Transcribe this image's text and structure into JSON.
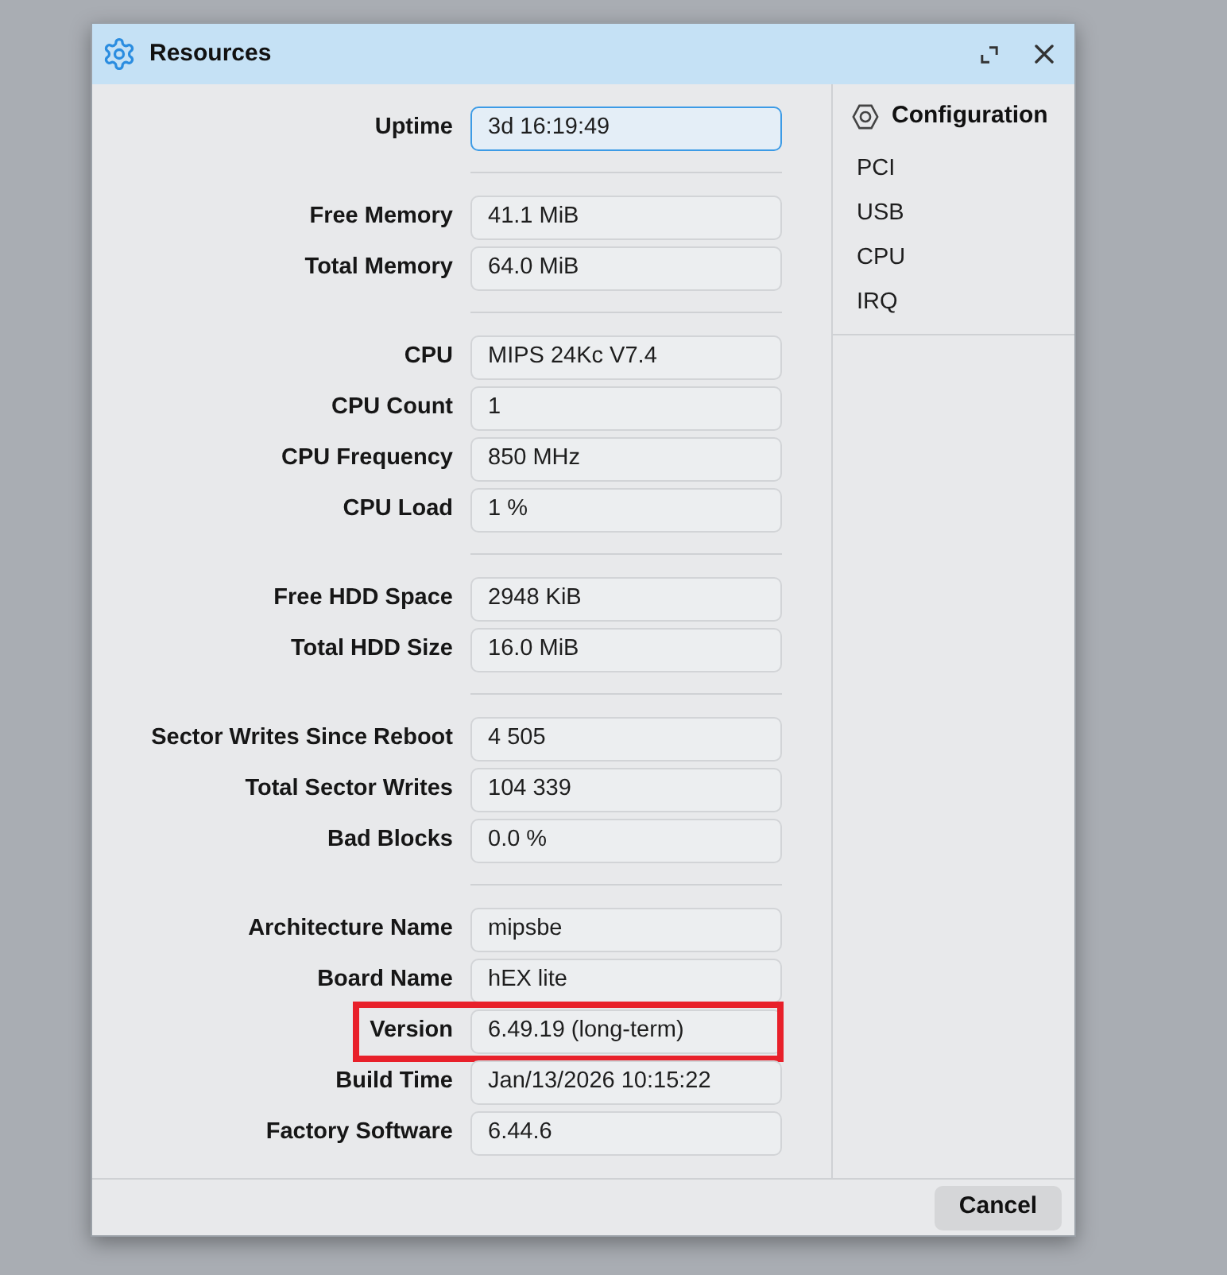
{
  "window": {
    "title": "Resources"
  },
  "groups": [
    {
      "fields": [
        {
          "label": "Uptime",
          "value": "3d 16:19:49",
          "focused": true,
          "highlighted": false
        }
      ]
    },
    {
      "fields": [
        {
          "label": "Free Memory",
          "value": "41.1 MiB",
          "focused": false,
          "highlighted": false
        },
        {
          "label": "Total Memory",
          "value": "64.0 MiB",
          "focused": false,
          "highlighted": false
        }
      ]
    },
    {
      "fields": [
        {
          "label": "CPU",
          "value": "MIPS 24Kc V7.4",
          "focused": false,
          "highlighted": false
        },
        {
          "label": "CPU Count",
          "value": "1",
          "focused": false,
          "highlighted": false
        },
        {
          "label": "CPU Frequency",
          "value": "850 MHz",
          "focused": false,
          "highlighted": false
        },
        {
          "label": "CPU Load",
          "value": "1 %",
          "focused": false,
          "highlighted": false
        }
      ]
    },
    {
      "fields": [
        {
          "label": "Free HDD Space",
          "value": "2948 KiB",
          "focused": false,
          "highlighted": false
        },
        {
          "label": "Total HDD Size",
          "value": "16.0 MiB",
          "focused": false,
          "highlighted": false
        }
      ]
    },
    {
      "fields": [
        {
          "label": "Sector Writes Since Reboot",
          "value": "4 505",
          "focused": false,
          "highlighted": false
        },
        {
          "label": "Total Sector Writes",
          "value": "104 339",
          "focused": false,
          "highlighted": false
        },
        {
          "label": "Bad Blocks",
          "value": "0.0 %",
          "focused": false,
          "highlighted": false
        }
      ]
    },
    {
      "fields": [
        {
          "label": "Architecture Name",
          "value": "mipsbe",
          "focused": false,
          "highlighted": false
        },
        {
          "label": "Board Name",
          "value": "hEX lite",
          "focused": false,
          "highlighted": false
        },
        {
          "label": "Version",
          "value": "6.49.19 (long-term)",
          "focused": false,
          "highlighted": true
        },
        {
          "label": "Build Time",
          "value": "Jan/13/2026 10:15:22",
          "focused": false,
          "highlighted": false
        },
        {
          "label": "Factory Software",
          "value": "6.44.6",
          "focused": false,
          "highlighted": false
        }
      ]
    }
  ],
  "sidebar": {
    "title": "Configuration",
    "items": [
      "PCI",
      "USB",
      "CPU",
      "IRQ"
    ]
  },
  "footer": {
    "buttons": [
      "Cancel"
    ]
  }
}
